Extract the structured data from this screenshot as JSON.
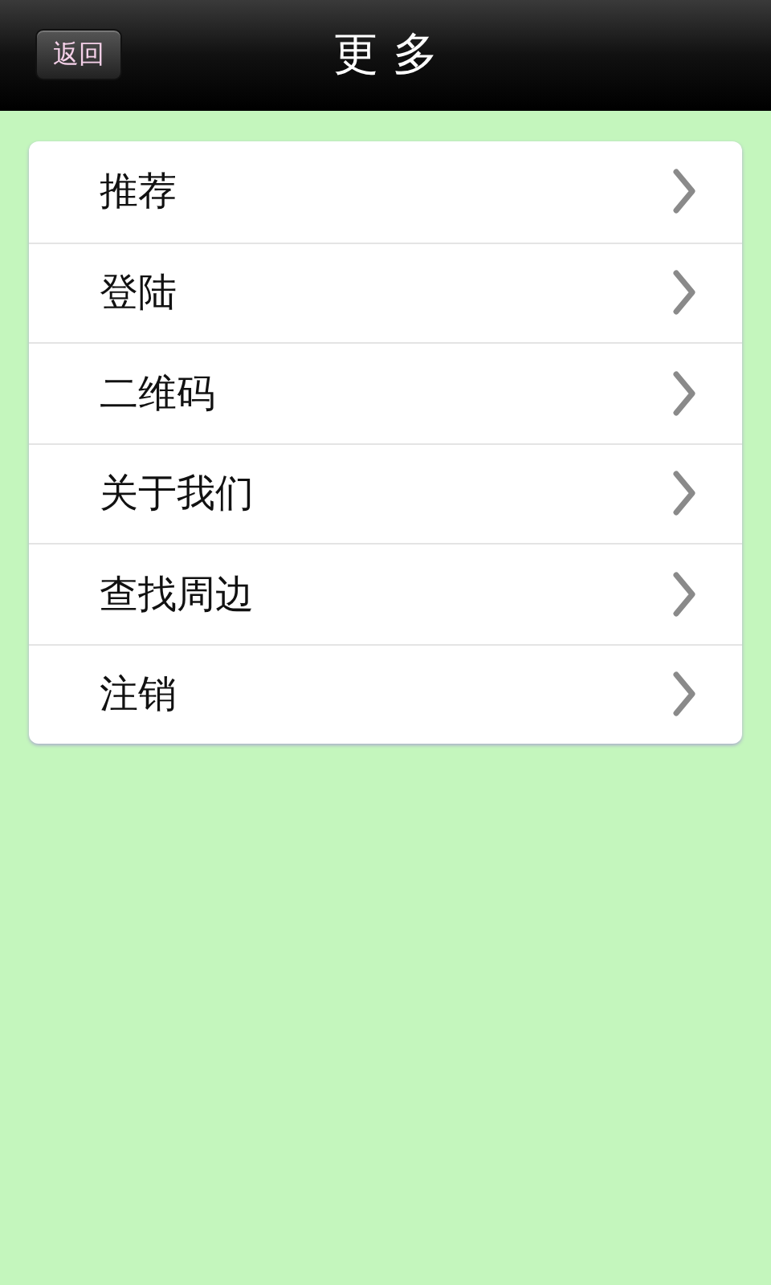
{
  "header": {
    "back_button": "返回",
    "title": "更 多"
  },
  "menu": [
    {
      "label": "推荐"
    },
    {
      "label": "登陆"
    },
    {
      "label": "二维码"
    },
    {
      "label": "关于我们"
    },
    {
      "label": "查找周边"
    },
    {
      "label": "注销"
    }
  ]
}
